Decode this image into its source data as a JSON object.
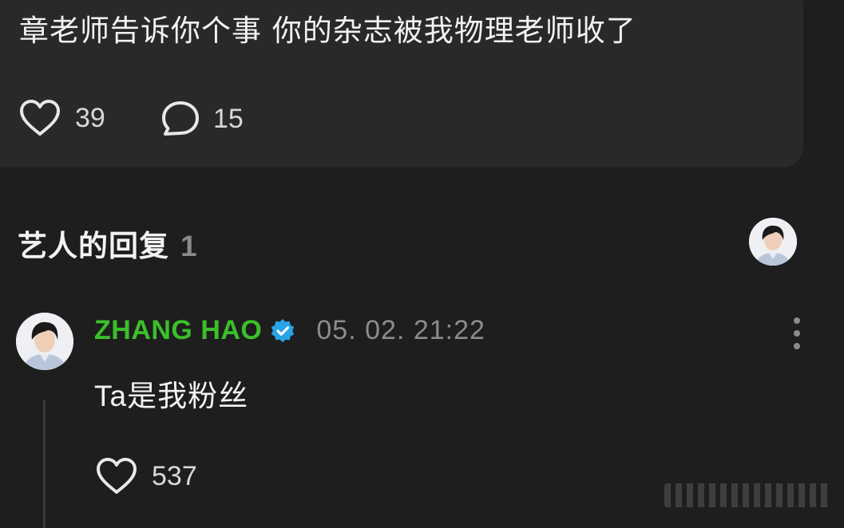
{
  "post": {
    "text": "章老师告诉你个事 你的杂志被我物理老师收了",
    "like_count": "39",
    "comment_count": "15"
  },
  "artist_replies": {
    "title": "艺人的回复",
    "count": "1"
  },
  "reply": {
    "name": "ZHANG HAO",
    "timestamp": "05. 02. 21:22",
    "text_latin": "Ta",
    "text_cjk": "是我粉丝",
    "like_count": "537"
  },
  "icons": {
    "like": "heart-outline-icon",
    "comment": "speech-bubble-icon",
    "verified": "verified-badge-icon",
    "more": "vertical-ellipsis-icon"
  },
  "colors": {
    "background": "#1e1e1e",
    "card": "#292929",
    "name_green": "#3bbf2a",
    "verified_blue": "#27a3e8",
    "muted_text": "#8c8c8c"
  }
}
